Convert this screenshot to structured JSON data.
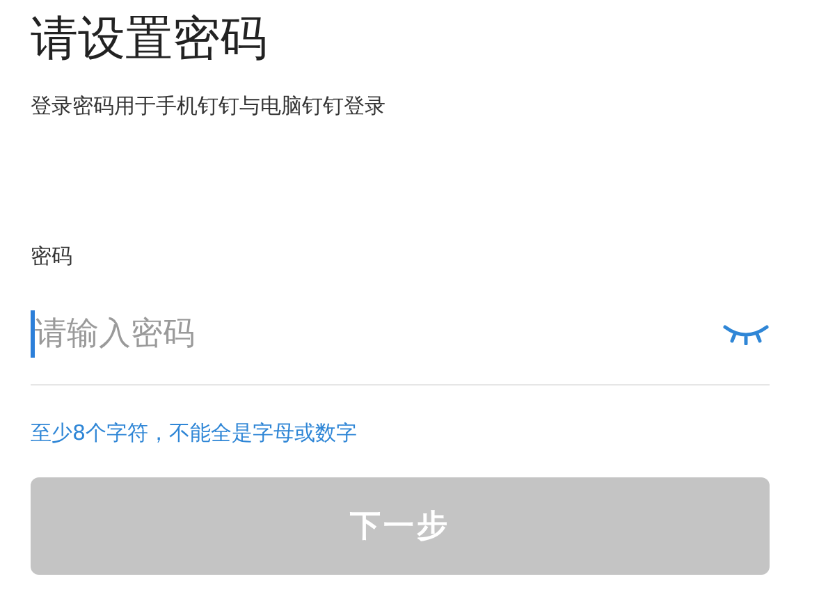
{
  "title": "请设置密码",
  "subtitle": "登录密码用于手机钉钉与电脑钉钉登录",
  "password_field": {
    "label": "密码",
    "placeholder": "请输入密码",
    "focused": true,
    "hidden": true
  },
  "hint": "至少8个字符，不能全是字母或数字",
  "next_button": {
    "label": "下一步",
    "disabled": true
  }
}
